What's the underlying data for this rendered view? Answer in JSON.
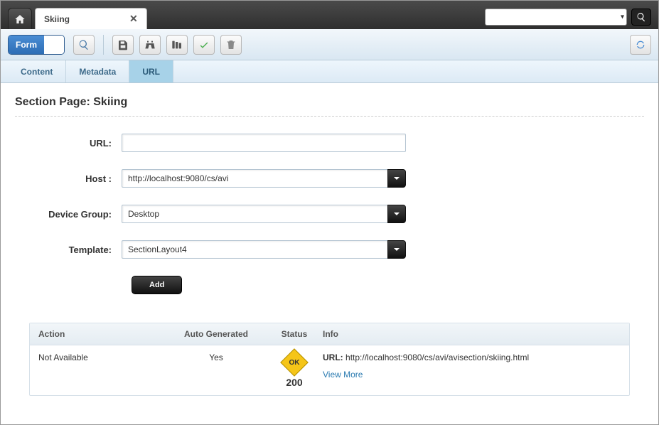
{
  "tab": {
    "title": "Skiing"
  },
  "toolbar": {
    "form_label": "Form"
  },
  "subtabs": {
    "content": "Content",
    "metadata": "Metadata",
    "url": "URL"
  },
  "page": {
    "title": "Section Page: Skiing"
  },
  "form": {
    "url_label": "URL:",
    "url_value": "",
    "host_label": "Host :",
    "host_value": "http://localhost:9080/cs/avi",
    "device_label": "Device Group:",
    "device_value": "Desktop",
    "template_label": "Template:",
    "template_value": "SectionLayout4",
    "add_label": "Add"
  },
  "results": {
    "headers": {
      "action": "Action",
      "auto": "Auto Generated",
      "status": "Status",
      "info": "Info"
    },
    "row": {
      "action": "Not Available",
      "auto": "Yes",
      "status_badge": "OK",
      "status_code": "200",
      "info_label": "URL:",
      "info_url": "http://localhost:9080/cs/avi/avisection/skiing.html",
      "view_more": "View More"
    }
  }
}
